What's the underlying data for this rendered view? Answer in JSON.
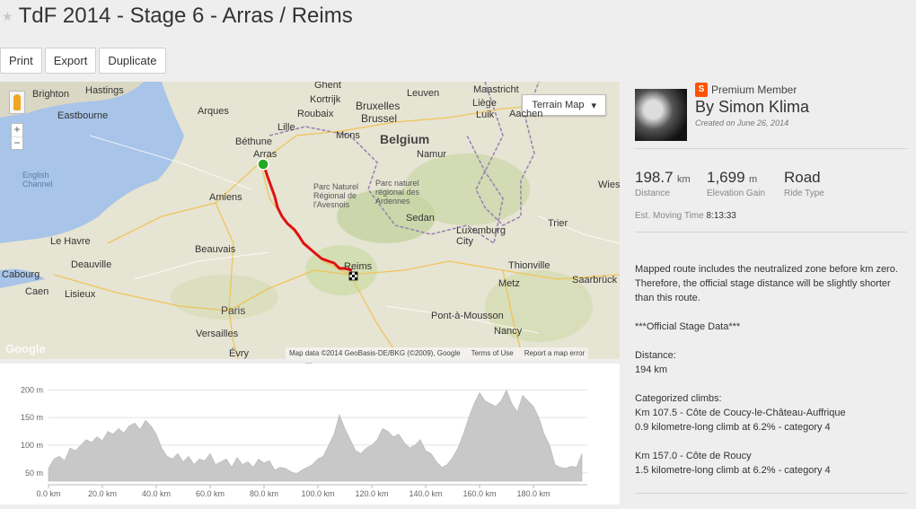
{
  "page": {
    "title": "TdF 2014 - Stage 6 - Arras / Reims",
    "star_icon": "star-icon"
  },
  "toolbar": {
    "print_label": "Print",
    "export_label": "Export",
    "duplicate_label": "Duplicate"
  },
  "map": {
    "terrain_button": "Terrain Map",
    "zoom_in": "+",
    "zoom_out": "−",
    "labels": {
      "brighton": "Brighton",
      "hastings": "Hastings",
      "eastbourne": "Eastbourne",
      "english_channel": "English\nChannel",
      "ghent": "Ghent",
      "kortrijk": "Kortrijk",
      "roubaix": "Roubaix",
      "lille": "Lille",
      "leuven": "Leuven",
      "bruxelles": "Bruxelles",
      "brussel": "Brussel",
      "maastricht": "Maastricht",
      "liege": "Liège",
      "luik": "Luik",
      "aachen": "Aachen",
      "arques": "Arques",
      "bethune": "Béthune",
      "arras": "Arras",
      "mons": "Mons",
      "belgium": "Belgium",
      "namur": "Namur",
      "parc_avesnois": "Parc Naturel\nRégional de\nl'Avesnois",
      "parc_ardennes": "Parc naturel\nrégional des\nArdennes",
      "amiens": "Amiens",
      "sedan": "Sedan",
      "luxembourg": "Luxemburg\nCity",
      "trier": "Trier",
      "wies": "Wies",
      "le_havre": "Le Havre",
      "beauvais": "Beauvais",
      "cabourg": "Cabourg",
      "deauville": "Deauville",
      "caen": "Caen",
      "lisieux": "Lisieux",
      "reims": "Reims",
      "thionville": "Thionville",
      "saarbrucken": "Saarbrück",
      "metz": "Metz",
      "paris": "Paris",
      "versailles": "Versailles",
      "evry": "Évry",
      "pont_a_mousson": "Pont-à-Mousson",
      "nancy": "Nancy",
      "google": "Google"
    },
    "attribution": "Map data ©2014 GeoBasis-DE/BKG (©2009), Google",
    "terms": "Terms of Use",
    "report": "Report a map error"
  },
  "owner": {
    "badge": "Premium Member",
    "name": "By Simon Klima",
    "created": "Created on June 26, 2014"
  },
  "stats": {
    "distance_value": "198.7",
    "distance_unit": "km",
    "distance_label": "Distance",
    "elevation_value": "1,699",
    "elevation_unit": "m",
    "elevation_label": "Elevation Gain",
    "type_value": "Road",
    "type_label": "Ride Type",
    "moving_label": "Est. Moving Time",
    "moving_value": "8:13:33"
  },
  "description": {
    "p1": "Mapped route includes the neutralized zone before km zero. Therefore, the official stage distance will be slightly shorter than this route.",
    "p2": "***Official Stage Data***",
    "p3": "Distance:\n194 km",
    "p4": "Categorized climbs:\nKm 107.5 - Côte de Coucy-le-Château-Auffrique\n0.9 kilometre-long climb at 6.2% - category 4",
    "p5": "Km 157.0 - Côte de Roucy\n1.5 kilometre-long climb at 6.2% - category 4"
  },
  "chart_data": {
    "type": "area",
    "xlabel": "",
    "ylabel": "",
    "x_unit": "km",
    "y_unit": "m",
    "xlim": [
      0,
      200
    ],
    "ylim": [
      35,
      215
    ],
    "x_ticks": [
      "0.0 km",
      "20.0 km",
      "40.0 km",
      "60.0 km",
      "80.0 km",
      "100.0 km",
      "120.0 km",
      "140.0 km",
      "160.0 km",
      "180.0 km"
    ],
    "y_ticks": [
      "50 m",
      "100 m",
      "150 m",
      "200 m"
    ],
    "grid": true,
    "color": "#c8c8c8",
    "x": [
      0,
      2,
      4,
      6,
      8,
      10,
      12,
      14,
      16,
      18,
      20,
      22,
      24,
      26,
      28,
      30,
      32,
      34,
      36,
      38,
      40,
      42,
      44,
      46,
      48,
      50,
      52,
      54,
      56,
      58,
      60,
      62,
      64,
      66,
      68,
      70,
      72,
      74,
      76,
      78,
      80,
      82,
      84,
      86,
      88,
      90,
      92,
      94,
      96,
      98,
      100,
      102,
      104,
      106,
      108,
      110,
      112,
      114,
      116,
      118,
      120,
      122,
      124,
      126,
      128,
      130,
      132,
      134,
      136,
      138,
      140,
      142,
      144,
      146,
      148,
      150,
      152,
      154,
      156,
      158,
      160,
      162,
      164,
      166,
      168,
      170,
      172,
      174,
      176,
      178,
      180,
      182,
      184,
      186,
      188,
      190,
      192,
      194,
      196,
      198
    ],
    "y": [
      58,
      75,
      80,
      72,
      95,
      90,
      100,
      110,
      105,
      115,
      108,
      125,
      120,
      130,
      122,
      135,
      140,
      128,
      145,
      135,
      120,
      95,
      80,
      75,
      85,
      70,
      80,
      65,
      75,
      72,
      85,
      65,
      70,
      75,
      60,
      78,
      65,
      70,
      60,
      75,
      68,
      72,
      55,
      60,
      58,
      52,
      48,
      55,
      60,
      65,
      75,
      80,
      100,
      120,
      155,
      130,
      110,
      90,
      85,
      95,
      100,
      110,
      130,
      125,
      115,
      120,
      105,
      95,
      100,
      110,
      90,
      85,
      70,
      60,
      65,
      78,
      95,
      120,
      150,
      175,
      195,
      180,
      175,
      170,
      180,
      200,
      175,
      160,
      190,
      180,
      170,
      150,
      120,
      100,
      65,
      60,
      58,
      62,
      60,
      85
    ]
  }
}
